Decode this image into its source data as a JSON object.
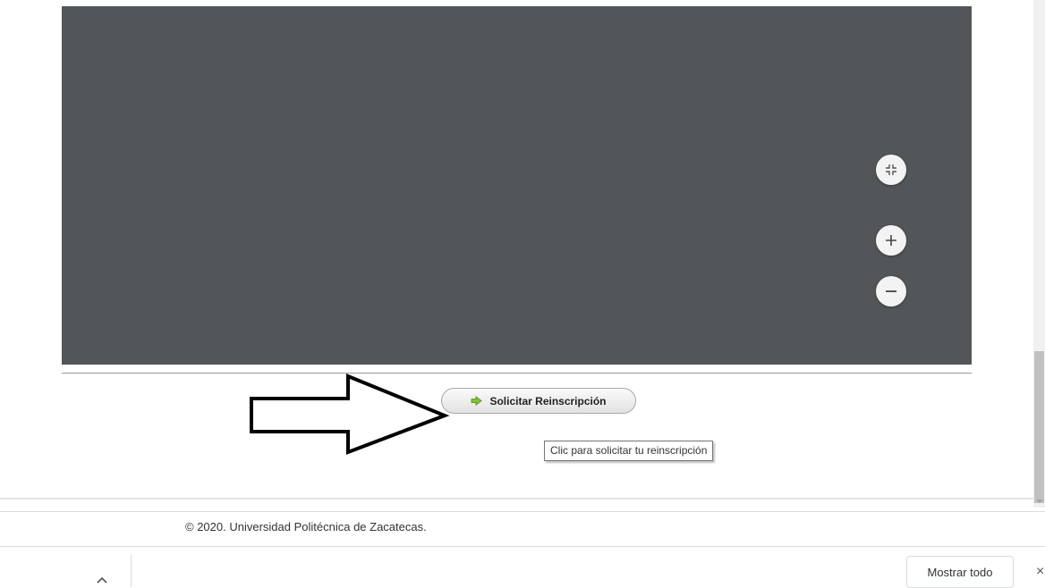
{
  "viewer": {
    "background": "#535659",
    "controls": [
      {
        "name": "fit-page-icon"
      },
      {
        "name": "zoom-in-icon"
      },
      {
        "name": "zoom-out-icon"
      }
    ]
  },
  "request": {
    "button_label": "Solicitar Reinscripción",
    "button_icon": "green-arrow-right-icon",
    "tooltip": "Clic para solicitar tu reinscripción"
  },
  "footer": {
    "copyright": "© 2020. Universidad Politécnica de Zacatecas."
  },
  "download_bar": {
    "show_all_label": "Mostrar todo",
    "close_label": "×"
  },
  "colors": {
    "accent_icon": "#6fbf2a",
    "viewer_bg": "#535659"
  }
}
